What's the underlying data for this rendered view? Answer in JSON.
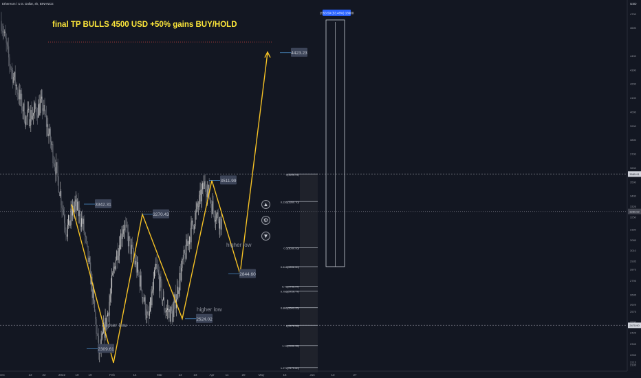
{
  "window": {
    "symbol_title": "Ethereum / U.S. Dollar, 4h, BINANCE",
    "currency": "USD"
  },
  "colors": {
    "background": "#131722",
    "candle_up": "#c8c8c8",
    "candle_down": "#6b6f78",
    "zigzag": "#f7c325",
    "headline": "#ffe83a",
    "label_bg": "#3c4458",
    "label_text": "#c4c8d2",
    "fib_line": "#8a8e98",
    "crosshair": "#5d606b",
    "target_dots": "#a23a3a",
    "measure_blue": "#2962ff"
  },
  "chart_data": {
    "type": "candlestick",
    "title": "final TP BULLS 4500 USD +50% gains BUY/HOLD",
    "ylim": [
      2150,
      4780
    ],
    "x_ticks": [
      "Dec",
      "13",
      "22",
      "2022",
      "10",
      "19",
      "Feb",
      "14",
      "Mar",
      "14",
      "23",
      "Apr",
      "11",
      "20",
      "May",
      "16",
      "Jun",
      "13",
      "27"
    ],
    "y_ticks": [
      4700,
      4600,
      4400,
      4300,
      4200,
      4100,
      4000,
      3900,
      3800,
      3700,
      3600,
      3500,
      3400,
      3325,
      3250,
      3160,
      3085,
      3010,
      2935,
      2875,
      2795,
      2695,
      2625,
      2575,
      2500,
      2425,
      2345,
      2265,
      2215,
      2195
    ],
    "price_path": [
      {
        "t": "Dec 1",
        "price": 4650
      },
      {
        "t": "Dec 5",
        "price": 4350
      },
      {
        "t": "Dec 10",
        "price": 4150
      },
      {
        "t": "Dec 16",
        "price": 3950
      },
      {
        "t": "Dec 22",
        "price": 4000
      },
      {
        "t": "Dec 28",
        "price": 4050
      },
      {
        "t": "Jan 3",
        "price": 3800
      },
      {
        "t": "Jan 6",
        "price": 3500
      },
      {
        "t": "Jan 10",
        "price": 3150
      },
      {
        "t": "Jan 14",
        "price": 3340
      },
      {
        "t": "Jan 19",
        "price": 3200
      },
      {
        "t": "Jan 22",
        "price": 2800
      },
      {
        "t": "Jan 24",
        "price": 2260
      },
      {
        "t": "Jan 28",
        "price": 2550
      },
      {
        "t": "Feb 4",
        "price": 2950
      },
      {
        "t": "Feb 8",
        "price": 3200
      },
      {
        "t": "Feb 12",
        "price": 3000
      },
      {
        "t": "Feb 18",
        "price": 2800
      },
      {
        "t": "Feb 24",
        "price": 2500
      },
      {
        "t": "Mar 1",
        "price": 2900
      },
      {
        "t": "Mar 7",
        "price": 2600
      },
      {
        "t": "Mar 14",
        "price": 2550
      },
      {
        "t": "Mar 18",
        "price": 2850
      },
      {
        "t": "Mar 23",
        "price": 3100
      },
      {
        "t": "Mar 27",
        "price": 3300
      },
      {
        "t": "Apr 2",
        "price": 3500
      },
      {
        "t": "Apr 6",
        "price": 3300
      },
      {
        "t": "Apr 8",
        "price": 3210
      }
    ],
    "zigzag_path": [
      3340,
      2209,
      3270,
      2524,
      3512,
      2845,
      4423
    ],
    "callouts": [
      {
        "label": "3342.31",
        "price": 3342.31
      },
      {
        "label": "2309.61",
        "price": 2309.61
      },
      {
        "label": "3270.43",
        "price": 3270.43
      },
      {
        "label": "2524.02",
        "price": 2524.02
      },
      {
        "label": "3511.99",
        "price": 3511.99
      },
      {
        "label": "2844.60",
        "price": 2844.6
      },
      {
        "label": "4423.23",
        "price": 4423.23
      }
    ],
    "annotations": [
      "higher low",
      "higher low",
      "higher low"
    ],
    "target_price": 4500,
    "fib_levels": [
      {
        "label": "0(3556.91)",
        "price": 3556.91
      },
      {
        "label": "0.236(3360.70)",
        "price": 3360.7
      },
      {
        "label": "0.5(3030.95)",
        "price": 3030.95
      },
      {
        "label": "0.618(2896.00)",
        "price": 2896.0
      },
      {
        "label": "0.75(2755.97)",
        "price": 2755.97
      },
      {
        "label": "0.786(2720.77)",
        "price": 2720.77
      },
      {
        "label": "0.886(2603.25)",
        "price": 2603.25
      },
      {
        "label": "1(2476.99)",
        "price": 2476.99
      },
      {
        "label": "1.13(2332.96)",
        "price": 2332.96
      },
      {
        "label": "1.272(2175.60)",
        "price": 2175.6
      }
    ],
    "hlines": [
      3556.91,
      3289.92,
      2476.99
    ],
    "price_badges": [
      {
        "label": "3585.91",
        "price": 3556.91
      },
      {
        "label": "3289.92",
        "price": 3289.92
      },
      {
        "label": "2475.90",
        "price": 2476.99
      }
    ],
    "measure_label": "1553.59 (53.48%) 18600"
  }
}
